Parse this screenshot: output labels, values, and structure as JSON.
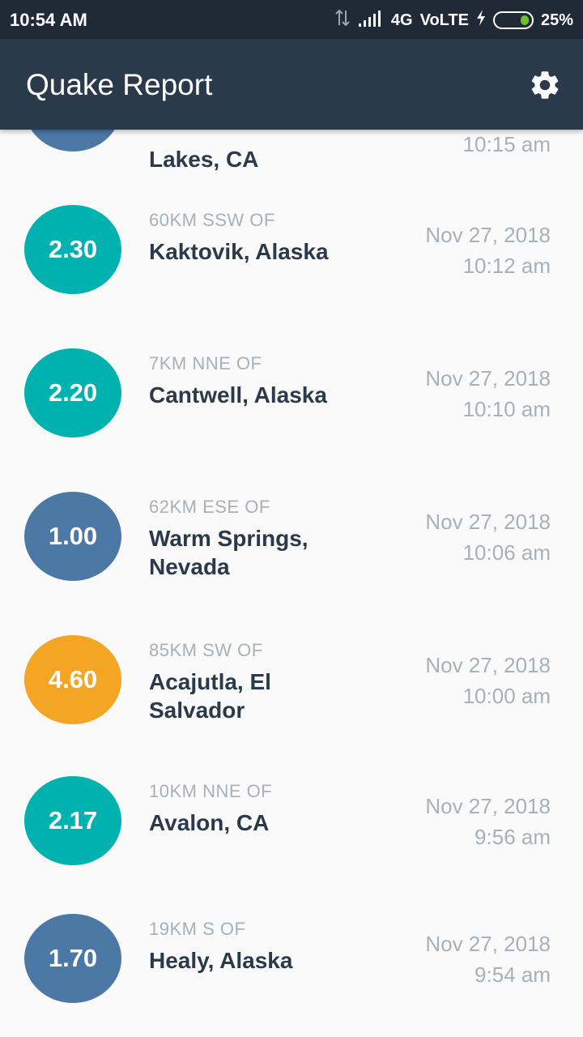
{
  "status_bar": {
    "time": "10:54 AM",
    "network": "4G",
    "volte": "VoLTE",
    "battery": "25%"
  },
  "app_bar": {
    "title": "Quake Report",
    "settings_icon": "gear-icon"
  },
  "colors": {
    "teal": "#00B2AF",
    "blue": "#4C78A6",
    "orange": "#F5A524"
  },
  "earthquakes": [
    {
      "magnitude": "",
      "offset": "",
      "place": "Lakes, CA",
      "date": "",
      "time": "10:15 am",
      "color": "#4C78A6"
    },
    {
      "magnitude": "2.30",
      "offset": "60KM SSW OF",
      "place": "Kaktovik, Alaska",
      "date": "Nov 27, 2018",
      "time": "10:12 am",
      "color": "#00B2AF"
    },
    {
      "magnitude": "2.20",
      "offset": "7KM NNE OF",
      "place": "Cantwell, Alaska",
      "date": "Nov 27, 2018",
      "time": "10:10 am",
      "color": "#00B2AF"
    },
    {
      "magnitude": "1.00",
      "offset": "62KM ESE OF",
      "place": "Warm Springs, Nevada",
      "date": "Nov 27, 2018",
      "time": "10:06 am",
      "color": "#4C78A6"
    },
    {
      "magnitude": "4.60",
      "offset": "85KM SW OF",
      "place": "Acajutla, El Salvador",
      "date": "Nov 27, 2018",
      "time": "10:00 am",
      "color": "#F5A524"
    },
    {
      "magnitude": "2.17",
      "offset": "10KM NNE OF",
      "place": "Avalon, CA",
      "date": "Nov 27, 2018",
      "time": "9:56 am",
      "color": "#00B2AF"
    },
    {
      "magnitude": "1.70",
      "offset": "19KM S OF",
      "place": "Healy, Alaska",
      "date": "Nov 27, 2018",
      "time": "9:54 am",
      "color": "#4C78A6"
    }
  ]
}
